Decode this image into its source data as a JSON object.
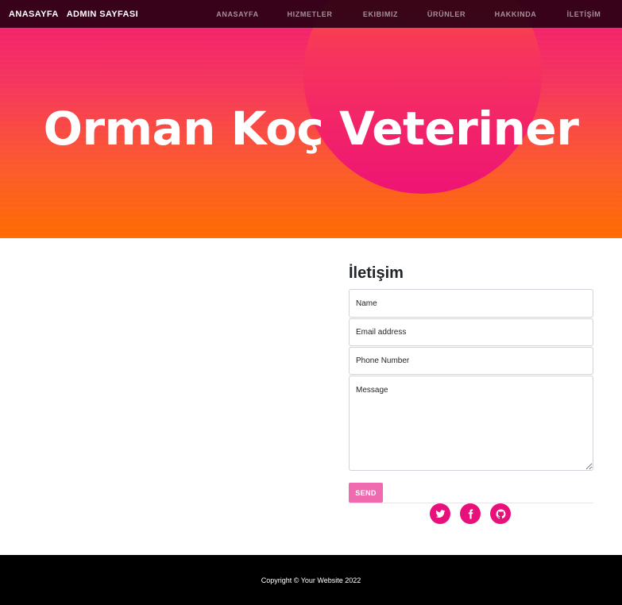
{
  "navbar": {
    "brand_home": "ANASAYFA",
    "brand_admin": "ADMIN SAYFASI",
    "links": [
      "ANASAYFA",
      "HIZMETLER",
      "EKIBIMIZ",
      "ÜRÜNLER",
      "HAKKINDA",
      "İLETİŞİM"
    ]
  },
  "hero": {
    "title": "Orman Koç Veteriner"
  },
  "contact": {
    "title": "İletişim",
    "name_placeholder": "Name",
    "email_placeholder": "Email address",
    "phone_placeholder": "Phone Number",
    "message_placeholder": "Message",
    "send_label": "SEND"
  },
  "social": [
    "twitter-icon",
    "facebook-icon",
    "github-icon"
  ],
  "footer": {
    "copyright": "Copyright © Your Website 2022"
  },
  "colors": {
    "accent": "#e8107a",
    "send_button": "#f06ab0",
    "hero_top": "#f21a6f",
    "hero_bottom": "#ff6b00"
  }
}
